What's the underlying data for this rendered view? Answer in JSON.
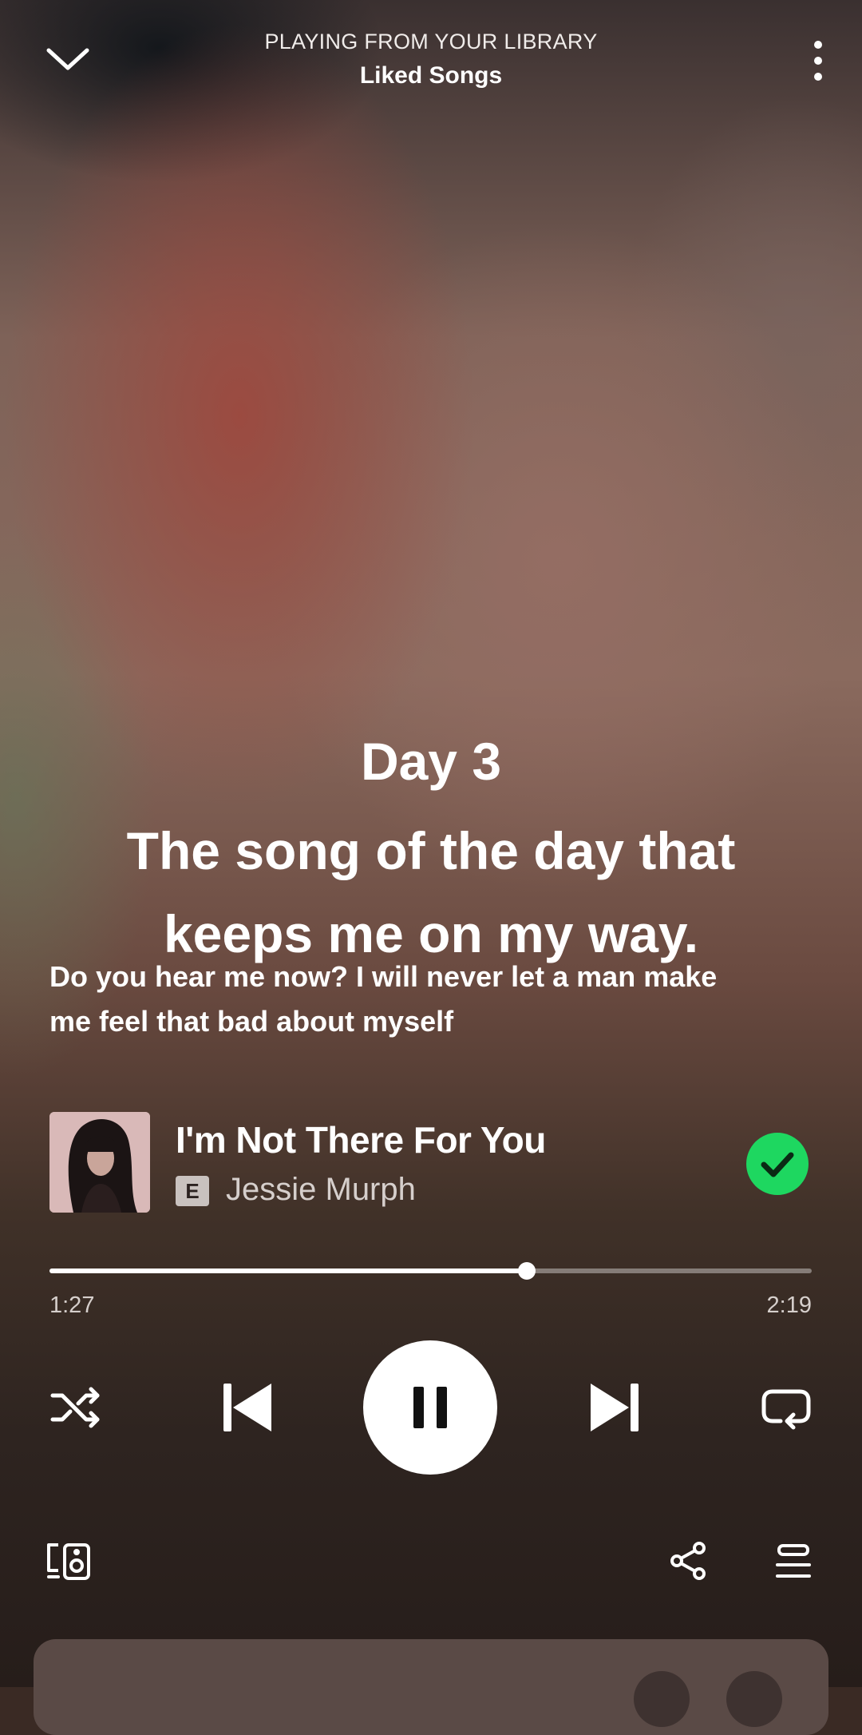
{
  "header": {
    "context_label": "PLAYING FROM YOUR LIBRARY",
    "context_name": "Liked Songs",
    "collapse_icon": "chevron-down-icon",
    "more_icon": "more-vertical-icon"
  },
  "overlay": {
    "day": "Day 3",
    "caption_line1": "The song of the day that",
    "caption_line2": "keeps me on my way."
  },
  "lyrics": {
    "line1": "Do you hear me now? I will never let a man make",
    "line2": "me feel that bad about myself"
  },
  "track": {
    "title": "I'm Not There For You",
    "explicit_label": "E",
    "artist": "Jessie Murph",
    "liked": true
  },
  "progress": {
    "elapsed": "1:27",
    "total": "2:19",
    "fraction": 0.626
  },
  "controls": {
    "shuffle_icon": "shuffle-icon",
    "previous_icon": "skip-previous-icon",
    "play_state": "playing",
    "next_icon": "skip-next-icon",
    "repeat_icon": "repeat-icon"
  },
  "footer": {
    "devices_icon": "connect-devices-icon",
    "share_icon": "share-icon",
    "queue_icon": "queue-icon"
  },
  "colors": {
    "accent": "#1ed760",
    "text": "#ffffff"
  }
}
